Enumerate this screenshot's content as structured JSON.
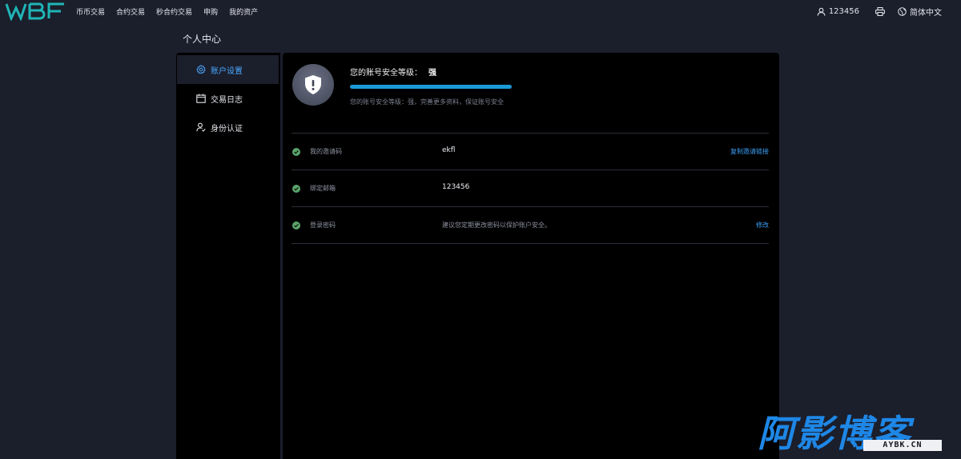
{
  "brand": {
    "logo_text": "WBF",
    "accent": "#1fb5b6"
  },
  "nav": {
    "items": [
      {
        "label": "币币交易"
      },
      {
        "label": "合约交易"
      },
      {
        "label": "秒合约交易"
      },
      {
        "label": "申购"
      },
      {
        "label": "我的资产"
      }
    ]
  },
  "top_right": {
    "user": "123456",
    "user_icon": "user-icon",
    "print_icon": "printer-icon",
    "language": "简体中文",
    "language_icon": "globe-icon"
  },
  "page_title": "个人中心",
  "sidebar": {
    "items": [
      {
        "label": "账户设置",
        "icon": "gear-icon",
        "active": true
      },
      {
        "label": "交易日志",
        "icon": "calendar-icon",
        "active": false
      },
      {
        "label": "身份认证",
        "icon": "user-check-icon",
        "active": false
      }
    ]
  },
  "security": {
    "title": "您的账号安全等级：",
    "level": "强",
    "progress": 1.0,
    "hint": "您的账号安全等级：强，完善更多资料，保证账号安全",
    "icon": "shield-alert-icon"
  },
  "rows": [
    {
      "label": "我的邀请码",
      "value": "ekfl",
      "action": "复制邀请链接"
    },
    {
      "label": "绑定邮箱",
      "value": "123456",
      "action": ""
    },
    {
      "label": "登录密码",
      "value": "建议您定期更改密码以保护账户安全。",
      "action": "修改"
    }
  ],
  "colors": {
    "background": "#1b1e2b",
    "panel": "#000000",
    "link": "#3b9ef5",
    "progress": "#1a9bd7",
    "check": "#5aa469"
  },
  "watermark": {
    "main": "阿影博客",
    "sub": "AYBK.CN"
  }
}
